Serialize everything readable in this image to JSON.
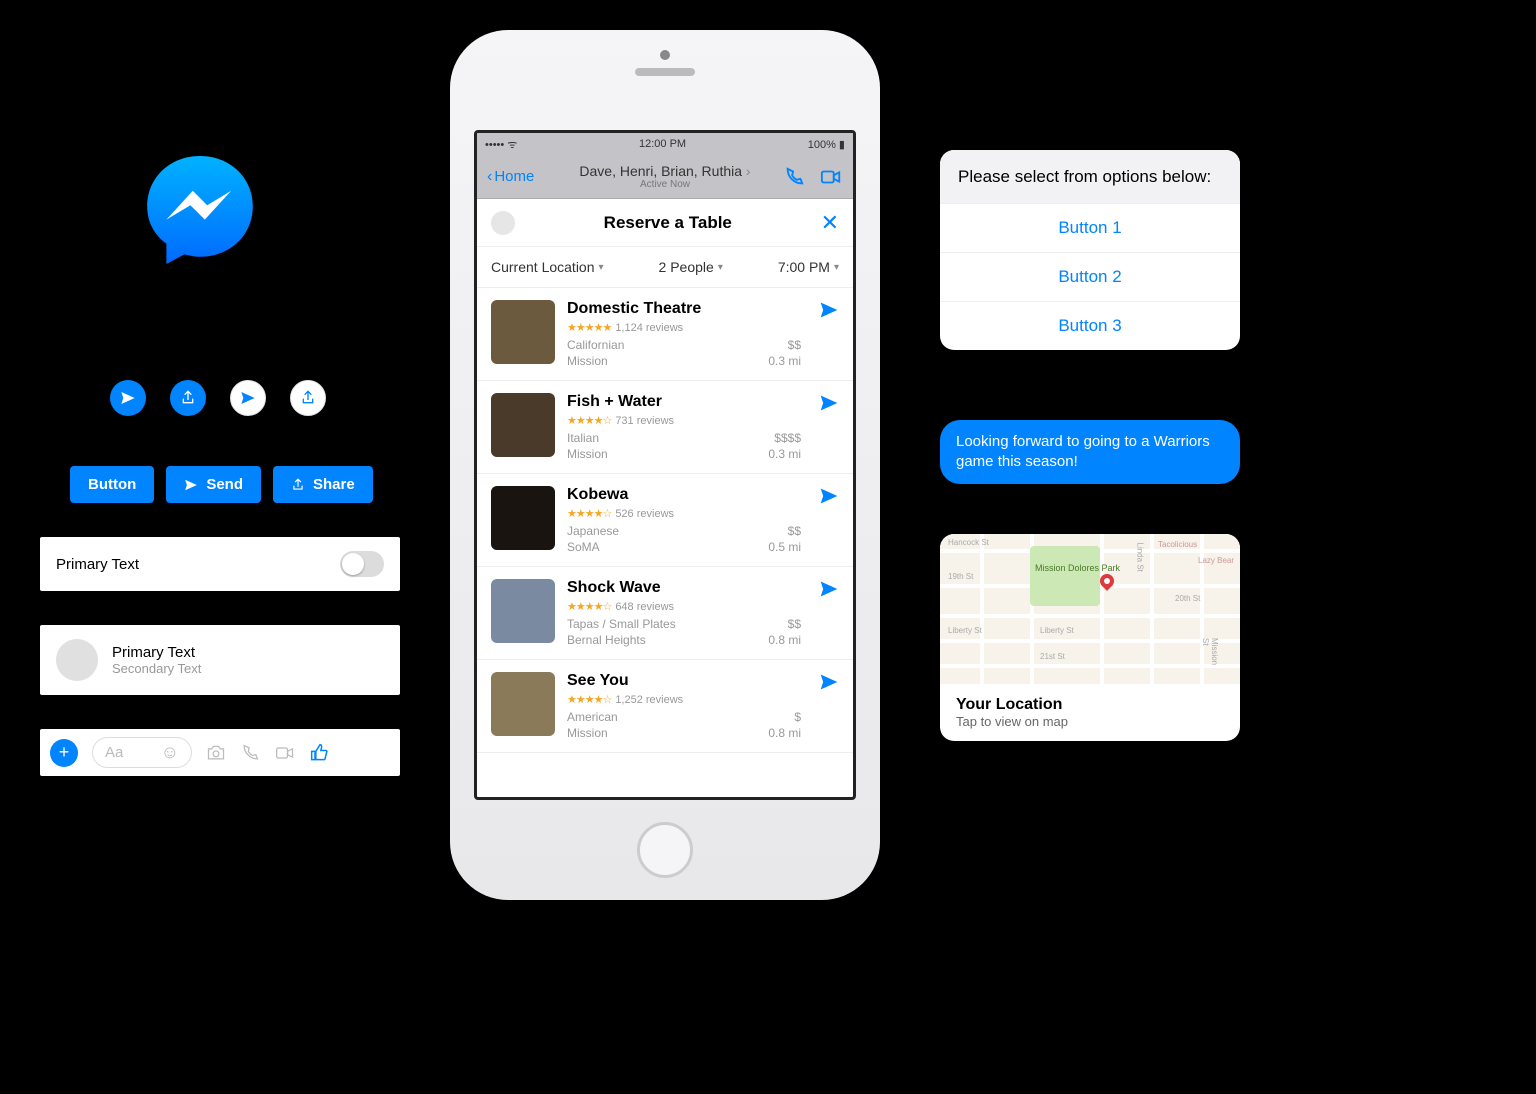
{
  "left": {
    "button_label": "Button",
    "send_label": "Send",
    "share_label": "Share",
    "primary_text": "Primary Text",
    "secondary_text": "Secondary Text",
    "composer_placeholder": "Aa"
  },
  "phone": {
    "status": {
      "time": "12:00 PM",
      "battery": "100%"
    },
    "nav": {
      "back": "Home",
      "title": "Dave, Henri, Brian, Ruthia",
      "subtitle": "Active Now"
    },
    "panel_title": "Reserve a Table",
    "filters": {
      "location": "Current Location",
      "people": "2 People",
      "time": "7:00 PM"
    },
    "restaurants": [
      {
        "name": "Domestic Theatre",
        "stars": 5,
        "reviews": "1,124 reviews",
        "cuisine": "Californian",
        "hood": "Mission",
        "price": "$$",
        "dist": "0.3 mi",
        "thumb": "#6b5a3e"
      },
      {
        "name": "Fish + Water",
        "stars": 4,
        "reviews": "731 reviews",
        "cuisine": "Italian",
        "hood": "Mission",
        "price": "$$$$",
        "dist": "0.3 mi",
        "thumb": "#4a3a2a"
      },
      {
        "name": "Kobewa",
        "stars": 4,
        "reviews": "526 reviews",
        "cuisine": "Japanese",
        "hood": "SoMA",
        "price": "$$",
        "dist": "0.5 mi",
        "thumb": "#1a1410"
      },
      {
        "name": "Shock Wave",
        "stars": 4,
        "reviews": "648 reviews",
        "cuisine": "Tapas / Small Plates",
        "hood": "Bernal Heights",
        "price": "$$",
        "dist": "0.8 mi",
        "thumb": "#7a8aa0"
      },
      {
        "name": "See You",
        "stars": 4,
        "reviews": "1,252 reviews",
        "cuisine": "American",
        "hood": "Mission",
        "price": "$",
        "dist": "0.8 mi",
        "thumb": "#8a7a5a"
      }
    ]
  },
  "right": {
    "options_prompt": "Please select from options below:",
    "options": [
      "Button 1",
      "Button 2",
      "Button 3"
    ],
    "bubble_text": "Looking forward to going to a Warriors game this season!",
    "map": {
      "title": "Your Location",
      "subtitle": "Tap to view on map",
      "park_label": "Mission Dolores Park",
      "streets": [
        "Hancock St",
        "19th St",
        "Liberty St",
        "21st St",
        "20th St",
        "Linda St",
        "Tacolicious",
        "Lazy Bear",
        "Mission St"
      ]
    }
  }
}
